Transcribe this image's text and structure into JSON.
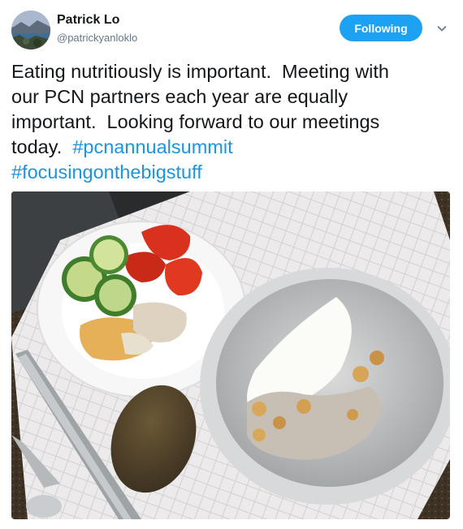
{
  "tweet": {
    "author_name": "Patrick Lo",
    "author_handle": "@patrickyanloklo",
    "follow_label": "Following",
    "text_line1": "Eating nutritiously is important.  Meeting with",
    "text_line2": "our PCN partners each year are equally",
    "text_line3": "important.  Looking forward to our meetings",
    "text_line4_prefix": "today.  ",
    "hashtag1": "#pcnannualsummit",
    "hashtag2": "#focusingonthebigstuff"
  },
  "icons": {
    "menu": "chevron-down-icon"
  },
  "colors": {
    "accent": "#1da1f2",
    "hashtag": "#1b95e0",
    "handle": "#657786"
  }
}
